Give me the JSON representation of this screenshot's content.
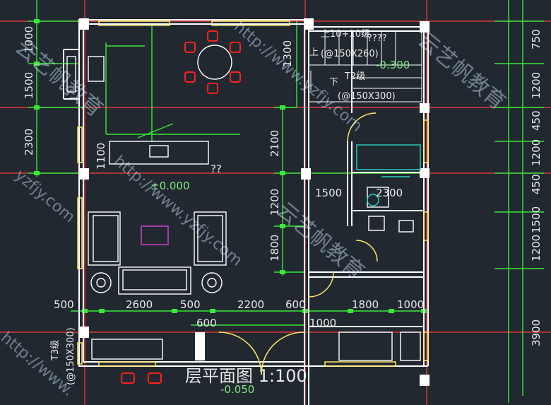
{
  "drawing": {
    "title": "层平面图  1:100",
    "room_label_unknown": "??",
    "stair_up_label": "上10+10级",
    "stair_up_marks": "????",
    "stair_up_size": "(@150X260)",
    "stair_up_word": "上",
    "stair_down_word": "下",
    "stair_down_label": "T2级",
    "stair_down_size": "(@150X300)",
    "level_main": "±0.000",
    "level_stair": "-0.300",
    "level_entry": "-0.050",
    "step_label": "T3级",
    "step_size": "(@150X300)",
    "colors": {
      "background": "#212830",
      "wall": "#ffffff",
      "grid": "#ff3b3b",
      "dimension": "#37e837",
      "furniture": "#ffffff",
      "window": "#ffe866",
      "chair": "#ff2020",
      "teal": "#2ad0c8"
    }
  },
  "dims_left": [
    "1000",
    "1500",
    "2300",
    "1100",
    "1200",
    "1800"
  ],
  "dims_right": [
    "750",
    "1200",
    "450",
    "1200",
    "450",
    "1500",
    "1200",
    "3900"
  ],
  "dims_center": [
    "1300",
    "2100",
    "1500",
    "2300"
  ],
  "dims_bottom": [
    "500",
    "2600",
    "500",
    "2200",
    "600",
    "1800",
    "1000",
    "600",
    "1000"
  ],
  "watermarks": [
    "云艺帆教育",
    "http://www.yzfjy.com",
    "云艺帆教育",
    "http://www.yzfjy.com",
    "云艺帆教育",
    "yzfjy.com",
    "http://www."
  ]
}
